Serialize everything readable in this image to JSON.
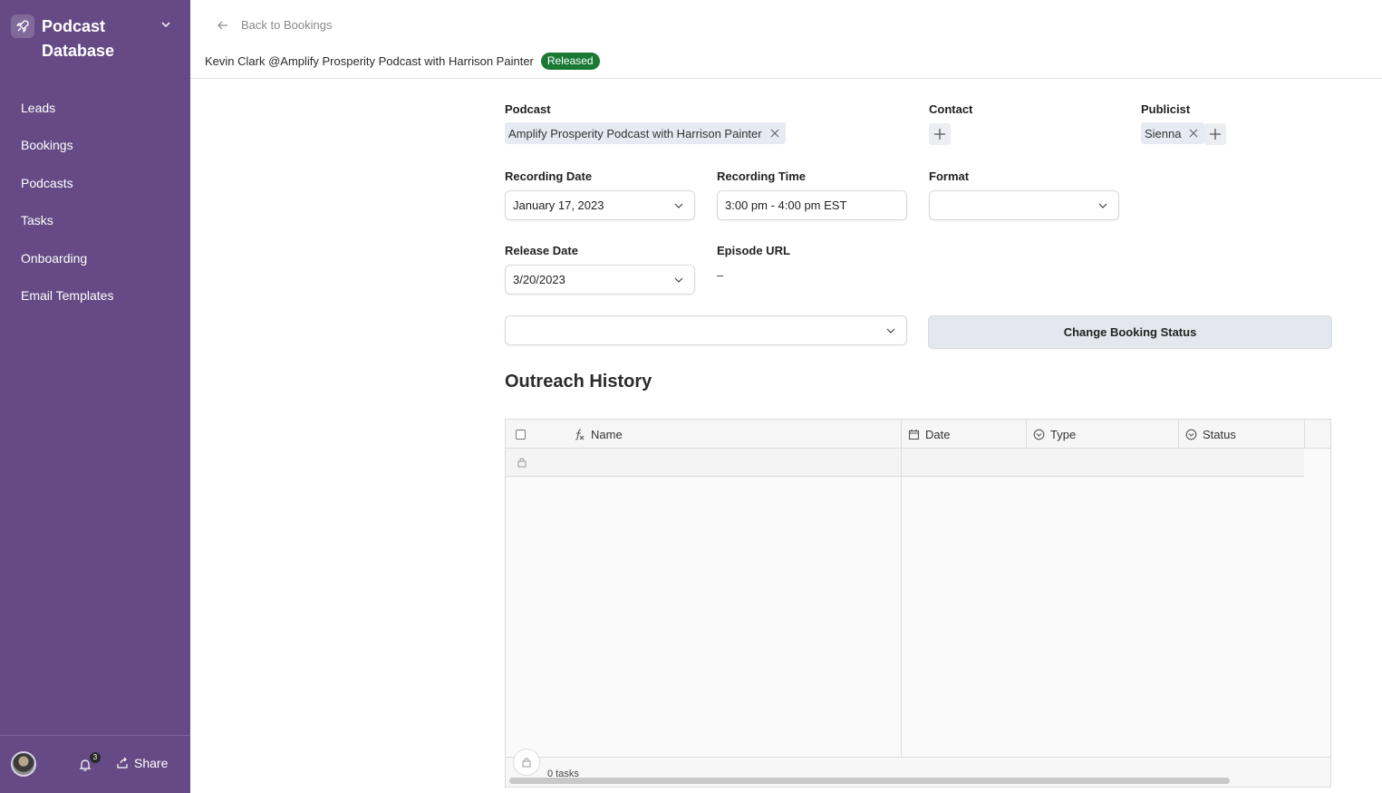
{
  "sidebar": {
    "brand": {
      "title": "Podcast Database",
      "logo_icon": "rocket-icon"
    },
    "nav": [
      {
        "label": "Leads"
      },
      {
        "label": "Bookings"
      },
      {
        "label": "Podcasts"
      },
      {
        "label": "Tasks"
      },
      {
        "label": "Onboarding"
      },
      {
        "label": "Email Templates"
      }
    ],
    "footer": {
      "notification_count": "3",
      "share_label": "Share"
    }
  },
  "header": {
    "back_label": "Back to Bookings",
    "record_title": "Kevin Clark @Amplify Prosperity Podcast with Harrison Painter",
    "status_badge": "Released"
  },
  "form": {
    "podcast": {
      "label": "Podcast",
      "value": "Amplify Prosperity Podcast with Harrison Painter"
    },
    "contact": {
      "label": "Contact"
    },
    "publicist": {
      "label": "Publicist",
      "value": "Sienna"
    },
    "recording_date": {
      "label": "Recording Date",
      "value": "January 17, 2023"
    },
    "recording_time": {
      "label": "Recording Time",
      "value": "3:00 pm - 4:00 pm EST"
    },
    "format": {
      "label": "Format",
      "value": ""
    },
    "release_date": {
      "label": "Release Date",
      "value": "3/20/2023"
    },
    "episode_url": {
      "label": "Episode URL",
      "value": "–"
    },
    "status_select": {
      "value": ""
    },
    "change_status_button": "Change Booking Status"
  },
  "outreach": {
    "title": "Outreach History",
    "columns": [
      {
        "label": "Name",
        "icon": "formula-icon"
      },
      {
        "label": "Date",
        "icon": "calendar-icon"
      },
      {
        "label": "Type",
        "icon": "select-icon"
      },
      {
        "label": "Status",
        "icon": "select-icon"
      }
    ],
    "footer_count": "0 tasks"
  },
  "colors": {
    "sidebar": "#654a85",
    "badge": "#1a7a34",
    "button": "#e4e7ee"
  }
}
